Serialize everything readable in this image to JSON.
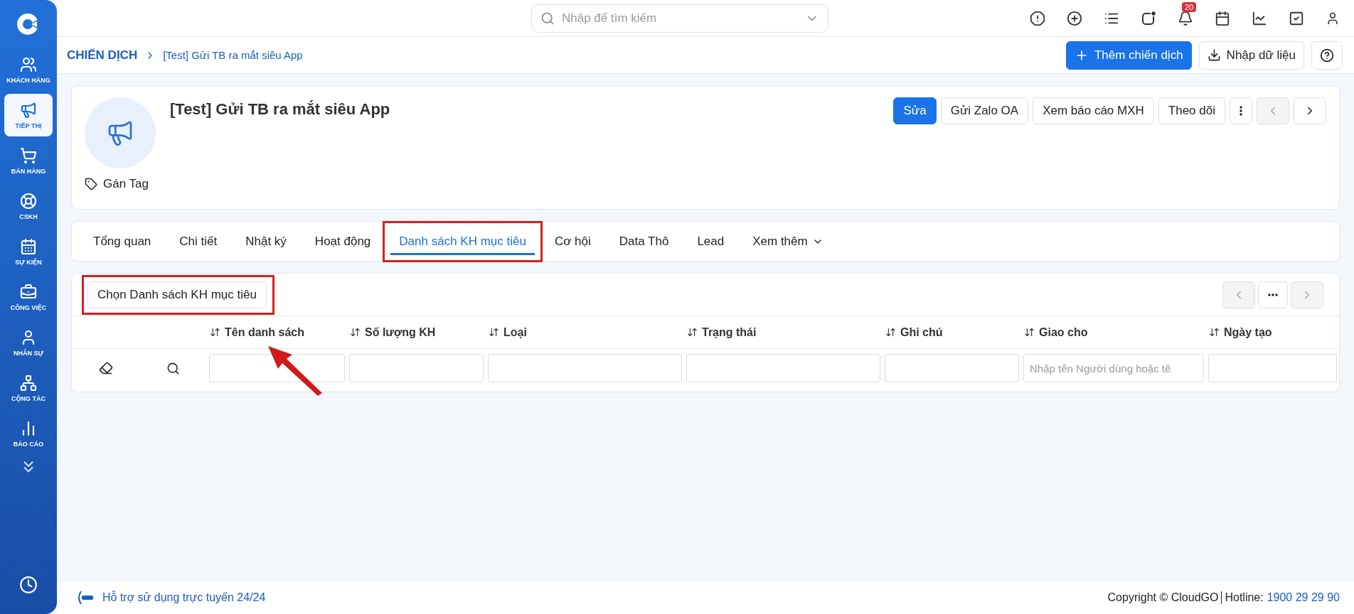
{
  "sidebar": {
    "items": [
      {
        "kind": "customers",
        "label": "KHÁCH HÀNG",
        "selected": false
      },
      {
        "kind": "marketing",
        "label": "TIẾP THỊ",
        "selected": true
      },
      {
        "kind": "sales",
        "label": "BÁN HÀNG",
        "selected": false
      },
      {
        "kind": "support",
        "label": "CSKH",
        "selected": false
      },
      {
        "kind": "events",
        "label": "SỰ KIỆN",
        "selected": false
      },
      {
        "kind": "work",
        "label": "CÔNG VIỆC",
        "selected": false
      },
      {
        "kind": "staff",
        "label": "NHÂN SỰ",
        "selected": false
      },
      {
        "kind": "collab",
        "label": "CỘNG TÁC",
        "selected": false
      },
      {
        "kind": "reports",
        "label": "BÁO CÁO",
        "selected": false
      }
    ]
  },
  "topbar": {
    "search": {
      "placeholder": "Nhập để tìm kiếm"
    },
    "notification_count": "20"
  },
  "breadcrumb": {
    "root": "CHIẾN DỊCH",
    "current": "[Test] Gửi TB ra mắt siêu App"
  },
  "page_actions": {
    "primary": "Thêm chiến dịch",
    "import": "Nhập dữ liệu"
  },
  "record": {
    "title": "[Test] Gửi TB ra mắt siêu App",
    "tag_label": "Gán Tag",
    "actions": [
      {
        "label": "Sửa",
        "primary": true
      },
      {
        "label": "Gửi Zalo OA",
        "primary": false
      },
      {
        "label": "Xem báo cáo MXH",
        "primary": false
      },
      {
        "label": "Theo dõi",
        "primary": false
      }
    ]
  },
  "tabs": [
    {
      "label": "Tổng quan",
      "selected": false,
      "highlighted": false
    },
    {
      "label": "Chi tiết",
      "selected": false,
      "highlighted": false
    },
    {
      "label": "Nhật ký",
      "selected": false,
      "highlighted": false
    },
    {
      "label": "Hoạt động",
      "selected": false,
      "highlighted": false
    },
    {
      "label": "Danh sách KH mục tiêu",
      "selected": true,
      "highlighted": true
    },
    {
      "label": "Cơ hội",
      "selected": false,
      "highlighted": false
    },
    {
      "label": "Data Thô",
      "selected": false,
      "highlighted": false
    },
    {
      "label": "Lead",
      "selected": false,
      "highlighted": false
    },
    {
      "label": "Xem thêm",
      "selected": false,
      "highlighted": false
    }
  ],
  "list_panel": {
    "select_button": {
      "label": "Chọn Danh sách KH mục tiêu",
      "highlighted": true
    },
    "table": {
      "columns": [
        {
          "label": "Tên danh sách"
        },
        {
          "label": "Số lượng KH"
        },
        {
          "label": "Loại"
        },
        {
          "label": "Trạng thái"
        },
        {
          "label": "Ghi chú"
        },
        {
          "label": "Giao cho",
          "filter_placeholder": "Nhập tên Người dùng hoặc tê"
        },
        {
          "label": "Ngày tạo"
        }
      ]
    }
  },
  "footer": {
    "support": "Hỗ trợ sử dụng trực tuyến 24/24",
    "copyright": "Copyright © CloudGO",
    "hotline_label": "Hotline:",
    "hotline": "1900 29 29 90"
  }
}
